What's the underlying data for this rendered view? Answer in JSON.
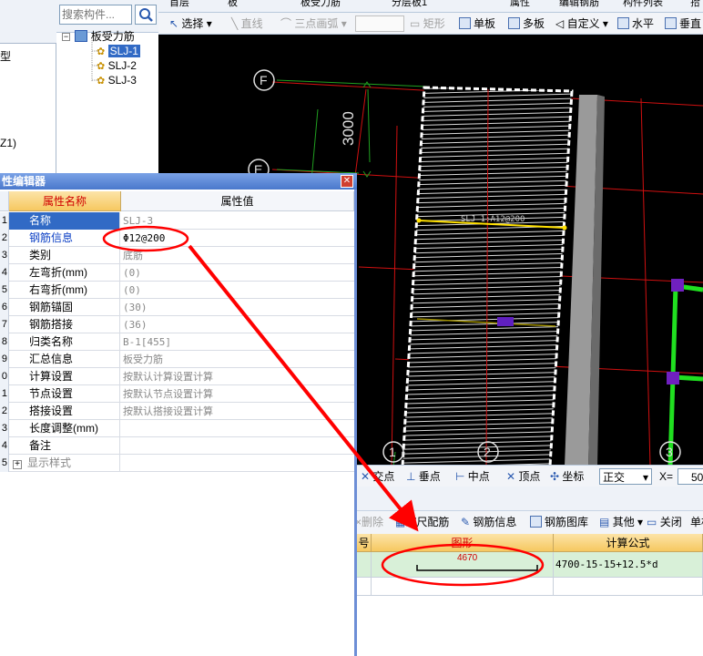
{
  "left_panel": {
    "labels": [
      "型",
      "Z1)"
    ]
  },
  "search": {
    "placeholder": "搜索构件..."
  },
  "tree": {
    "root": "板受力筋",
    "items": [
      "SLJ-1",
      "SLJ-2",
      "SLJ-3"
    ],
    "selected_index": 0
  },
  "top_strip": {
    "items": [
      "首层",
      "板",
      "板受力筋",
      "分层板1",
      "属性",
      "编辑钢筋",
      "构件列表",
      "拾"
    ]
  },
  "draw_toolbar": {
    "select": "选择",
    "line": "直线",
    "arc": "三点画弧",
    "rect": "矩形",
    "single_board": "单板",
    "multi_board": "多板",
    "custom": "自定义",
    "horizontal": "水平",
    "vertical": "垂直"
  },
  "cad": {
    "axis_labels": [
      "F",
      "E",
      "1",
      "2",
      "3"
    ],
    "dimension": "3000",
    "rebar_annotation": "SLJ-1:A12@200"
  },
  "snap_bar": {
    "items": [
      "交点",
      "垂点",
      "中点",
      "顶点",
      "坐标"
    ],
    "mode": "正交",
    "x_label": "X=",
    "x_value": "50"
  },
  "rebar_toolbar": {
    "delete": "删除",
    "scale": "缩尺配筋",
    "info": "钢筋信息",
    "library": "钢筋图库",
    "other": "其他",
    "close": "关闭",
    "single": "单构"
  },
  "rebar_table": {
    "headers": [
      "号",
      "图形",
      "计算公式"
    ],
    "rows": [
      {
        "shape_length": "4670",
        "formula": "4700-15-15+12.5*d"
      }
    ]
  },
  "property_editor": {
    "title": "性编辑器",
    "col_name": "属性名称",
    "col_value": "属性值",
    "rows": [
      {
        "num": "1",
        "name": "名称",
        "value": "SLJ-3"
      },
      {
        "num": "2",
        "name": "钢筋信息",
        "value": "Φ12@200"
      },
      {
        "num": "3",
        "name": "类别",
        "value": "底筋"
      },
      {
        "num": "4",
        "name": "左弯折(mm)",
        "value": "(0)"
      },
      {
        "num": "5",
        "name": "右弯折(mm)",
        "value": "(0)"
      },
      {
        "num": "6",
        "name": "钢筋锚固",
        "value": "(30)"
      },
      {
        "num": "7",
        "name": "钢筋搭接",
        "value": "(36)"
      },
      {
        "num": "8",
        "name": "归类名称",
        "value": "B-1[455]"
      },
      {
        "num": "9",
        "name": "汇总信息",
        "value": "板受力筋"
      },
      {
        "num": "0",
        "name": "计算设置",
        "value": "按默认计算设置计算"
      },
      {
        "num": "1",
        "name": "节点设置",
        "value": "按默认节点设置计算"
      },
      {
        "num": "2",
        "name": "搭接设置",
        "value": "按默认搭接设置计算"
      },
      {
        "num": "3",
        "name": "长度调整(mm)",
        "value": ""
      },
      {
        "num": "4",
        "name": "备注",
        "value": ""
      },
      {
        "num": "5",
        "name": "显示样式",
        "value": ""
      }
    ]
  },
  "colors": {
    "annotation_red": "#ff0000",
    "selection_blue": "#316ac5",
    "header_gold": "#f6c860",
    "row_green": "#d8f0d8",
    "cad_black": "#000000"
  }
}
